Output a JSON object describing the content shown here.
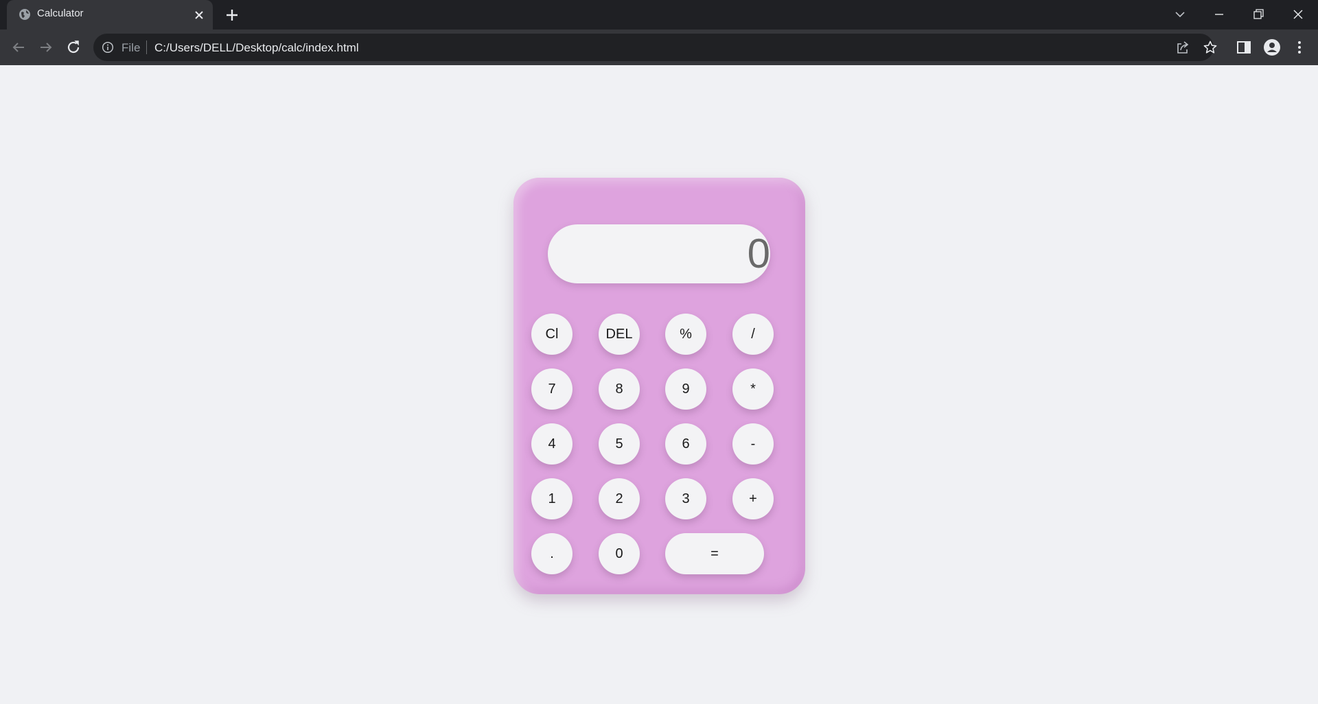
{
  "browser": {
    "tab_title": "Calculator",
    "address_scheme_label": "File",
    "address_url": "C:/Users/DELL/Desktop/calc/index.html"
  },
  "calculator": {
    "display_value": "0",
    "keys": {
      "clear": "Cl",
      "delete": "DEL",
      "percent": "%",
      "divide": "/",
      "seven": "7",
      "eight": "8",
      "nine": "9",
      "multiply": "*",
      "four": "4",
      "five": "5",
      "six": "6",
      "subtract": "-",
      "one": "1",
      "two": "2",
      "three": "3",
      "add": "+",
      "decimal": ".",
      "zero": "0",
      "equals": "="
    }
  },
  "colors": {
    "calculator_body": "#dea3de",
    "key_face": "#f3f3f5",
    "page_background": "#f0f1f4",
    "display_text": "#6a6a6a"
  }
}
